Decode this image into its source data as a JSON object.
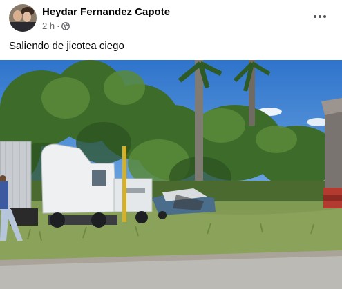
{
  "post": {
    "author": "Heydar Fernandez Capote",
    "time": "2 h",
    "separator": "·",
    "privacy_icon": "globe-icon",
    "more_icon": "more-options-icon",
    "text": "Saliendo de jicotea ciego"
  },
  "colors": {
    "name_text": "#050505",
    "meta_text": "#65676b",
    "sky": "#3c7fd0"
  },
  "photo": {
    "subject": "traffic accident scene"
  }
}
